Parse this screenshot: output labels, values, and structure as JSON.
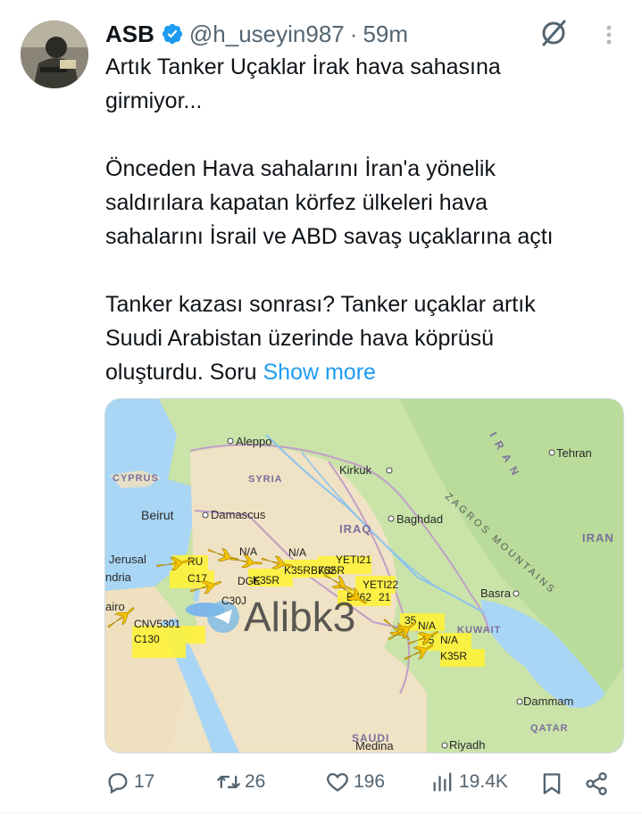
{
  "tweet": {
    "author_name": "ASB",
    "handle": "@h_useyin987",
    "separator": "·",
    "time": "59m",
    "lines_p1": [
      "Artık Tanker Uçaklar İrak hava sahasına",
      "girmiyor..."
    ],
    "lines_p2": [
      "Önceden Hava sahalarını İran'a yönelik",
      "saldırılara kapatan körfez ülkeleri hava",
      "sahalarını İsrail ve ABD savaş uçaklarına açtı"
    ],
    "lines_p3": [
      "Tanker kazası sonrası? Tanker uçaklar artık",
      "Suudi Arabistan üzerinde hava köprüsü",
      "oluşturdu. Soru"
    ],
    "show_more": "Show more"
  },
  "map": {
    "watermark": "Alibk3",
    "places": {
      "aleppo": "Aleppo",
      "tehran": "Tehran",
      "cyprus": "CYPRUS",
      "syria": "SYRIA",
      "kirkuk": "Kirkuk",
      "beirut": "Beirut",
      "damascus": "Damascus",
      "baghdad": "Baghdad",
      "iraq": "IRAQ",
      "iran_country": "IRAN",
      "iran_arc": "IRAN",
      "zagros": "ZAGROS MOUNTAINS",
      "jerusalem": "Jerusal",
      "andria": "ndria",
      "cairo": "airo",
      "basra": "Basra",
      "kuwait": "KUWAIT",
      "dammam": "Dammam",
      "qatar": "QATAR",
      "saudi": "SAUDI",
      "medina": "Medina",
      "riyadh": "Riyadh"
    },
    "flight_labels": {
      "c17": "C17",
      "c30j": "C30J",
      "k35r_1": "K35R",
      "k35r_2": "K35R",
      "k35r_3": "K35R",
      "k35r_b762": "K35RB762",
      "yeti21": "YETI21",
      "yeti22": "YETI22",
      "b762": "B762",
      "na_1": "N/A",
      "na_2": "N/A",
      "na_3": "N/A",
      "na_4": "N/A",
      "ru": "RU",
      "dge": "DGE",
      "cnv5301": "CNV5301",
      "c130": "C130",
      "n35": "35",
      "n35b": "35",
      "n21": "21"
    }
  },
  "actions": {
    "replies": "17",
    "reposts": "26",
    "likes": "196",
    "views": "19.4K"
  },
  "colors": {
    "link": "#1d9bf0",
    "verified": "#1d9bf0",
    "muted": "#536471",
    "plane_yellow": "#f7c400",
    "label_yellow": "#fff23a"
  }
}
